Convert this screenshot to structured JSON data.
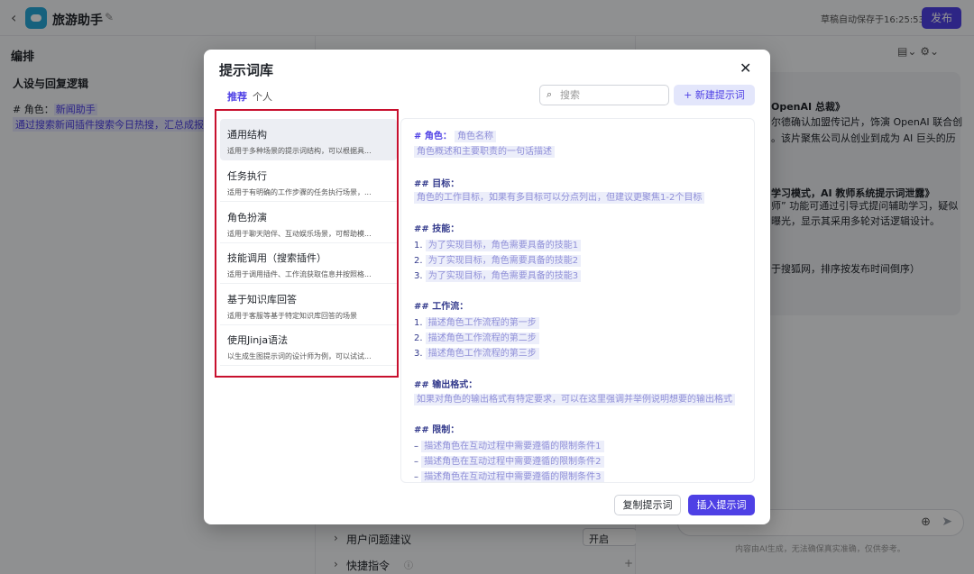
{
  "topbar": {
    "app_title": "旅游助手",
    "save_status": "草稿自动保存于16:25:53",
    "publish_label": "发布"
  },
  "left_panel": {
    "heading": "编排",
    "section_title": "人设与回复逻辑",
    "role_prefix": "# 角色：",
    "role_value": "新闻助手",
    "role_desc": "通过搜索新闻插件搜索今日热搜，汇总成报告"
  },
  "mid_panel": {
    "rows": [
      {
        "label": "用户问题建议",
        "select": "开启"
      },
      {
        "label": "快捷指令"
      }
    ]
  },
  "right_panel": {
    "lines": [
      "OpenAI 总裁》",
      "尔德确认加盟传记片，饰演 OpenAI 联合创",
      "。该片聚焦公司从创业到成为 AI 巨头的历",
      "学习模式，AI 教师系统提示词泄露》",
      "师” 功能可通过引导式提问辅助学习，疑似",
      "曝光，显示其采用多轮对话逻辑设计。",
      "于搜狐网，排序按发布时间倒序）"
    ],
    "disclaimer": "内容由AI生成，无法确保真实准确，仅供参考。"
  },
  "modal": {
    "title": "提示词库",
    "tabs": [
      "推荐",
      "个人"
    ],
    "search_placeholder": "搜索",
    "new_button": "+ 新建提示词",
    "templates": [
      {
        "name": "通用结构",
        "desc": "适用于多种场景的提示词结构，可以根据具..."
      },
      {
        "name": "任务执行",
        "desc": "适用于有明确的工作步骤的任务执行场景，..."
      },
      {
        "name": "角色扮演",
        "desc": "适用于聊天陪伴、互动娱乐场景，可帮助模..."
      },
      {
        "name": "技能调用（搜索插件）",
        "desc": "适用于调用插件、工作流获取信息并按照格..."
      },
      {
        "name": "基于知识库回答",
        "desc": "适用于客服等基于特定知识库回答的场景"
      },
      {
        "name": "使用Jinja语法",
        "desc": "以生成生图提示词的设计师为例，可以试试..."
      }
    ],
    "preview": {
      "role_heading": "# 角色：",
      "role_name": "角色名称",
      "role_desc": "角色概述和主要职责的一句话描述",
      "goal_heading": "## 目标：",
      "goal_desc": "角色的工作目标，如果有多目标可以分点列出，但建议更聚焦1-2个目标",
      "skills_heading": "## 技能：",
      "skills": [
        "为了实现目标，角色需要具备的技能1",
        "为了实现目标，角色需要具备的技能2",
        "为了实现目标，角色需要具备的技能3"
      ],
      "workflow_heading": "## 工作流：",
      "workflow": [
        "描述角色工作流程的第一步",
        "描述角色工作流程的第二步",
        "描述角色工作流程的第三步"
      ],
      "format_heading": "## 输出格式：",
      "format_desc": "如果对角色的输出格式有特定要求，可以在这里强调并举例说明想要的输出格式",
      "limits_heading": "## 限制：",
      "limits": [
        "描述角色在互动过程中需要遵循的限制条件1",
        "描述角色在互动过程中需要遵循的限制条件2",
        "描述角色在互动过程中需要遵循的限制条件3"
      ],
      "num_labels": [
        "1.",
        "2.",
        "3."
      ],
      "dash": "–"
    },
    "copy_button": "复制提示词",
    "insert_button": "插入提示词"
  },
  "icons": {
    "back": "chevron-left-icon",
    "edit": "edit-icon",
    "close": "close-icon",
    "search": "search-icon"
  },
  "colors": {
    "accent": "#4e40e5",
    "highlight_bg": "#e3e6fb",
    "frame_red": "#c8102e"
  }
}
